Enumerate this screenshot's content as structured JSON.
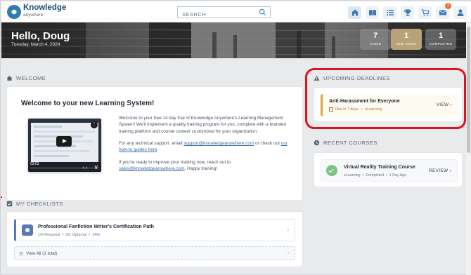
{
  "brand": {
    "title": "Knowledge",
    "subtitle": "anywhere"
  },
  "search": {
    "placeholder": "SEARCH"
  },
  "nav": {
    "icons": [
      "home-icon",
      "book-icon",
      "list-icon",
      "trophy-icon",
      "cart-icon",
      "mail-icon",
      "user-icon"
    ],
    "mail_badge": "2"
  },
  "hero": {
    "greeting": "Hello, Doug",
    "date": "Tuesday, March 4, 2024",
    "stats": [
      {
        "value": "7",
        "label": "TASKS"
      },
      {
        "value": "1",
        "label": "DUE SOON"
      },
      {
        "value": "1",
        "label": "COMPLETED"
      }
    ]
  },
  "welcome": {
    "section_title": "WELCOME",
    "heading": "Welcome to your new Learning System!",
    "video": {
      "time": "03:53"
    },
    "para1": "Welcome to your free 14 day trial of Knowledge Anywhere's Learning Management System! We'll implement a quality training program for you, complete with a branded training platform and course content customized for your organization.",
    "para2_prefix": "For any technical support, email ",
    "para2_email": "support@knowledgeanywhere.com",
    "para2_mid": " or check out ",
    "para2_link": "our how-to guides here",
    "para2_suffix": ".",
    "para3_prefix": "If you're ready to improve your training now, reach out to ",
    "para3_email": "sales@knowledgeanywhere.com",
    "para3_suffix": ". Happy training!"
  },
  "checklists": {
    "section_title": "MY CHECKLISTS",
    "item": {
      "title": "Professional Fanfiction Writer's Certification Path",
      "required": "1/6 Required",
      "optional": "0/1 Optional",
      "percent": "14%"
    },
    "view_all": "View All (1 total)"
  },
  "deadlines": {
    "section_title": "UPCOMING DEADLINES",
    "item": {
      "title": "Anti-Harassment for Everyone",
      "due": "Due in 7 days",
      "type": "eLearning",
      "action": "VIEW"
    }
  },
  "recent": {
    "section_title": "RECENT COURSES",
    "item": {
      "title": "Virtual Reality Training Course",
      "type": "eLearning",
      "status": "Completed",
      "when": "1 Day Ago",
      "action": "REVIEW"
    }
  },
  "colors": {
    "accent": "#1b4e7a",
    "highlight": "#e0101c",
    "deadline": "#e0a63b",
    "completed": "#7bc47f"
  }
}
